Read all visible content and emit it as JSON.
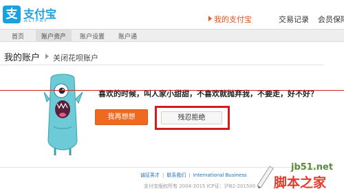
{
  "header": {
    "logo_glyph": "支",
    "logo_name": "支付宝",
    "logo_en": "ALIPAY",
    "nav": [
      {
        "label": "我的支付宝"
      },
      {
        "label": "交易记录"
      },
      {
        "label": "会员保障"
      }
    ]
  },
  "subnav": {
    "items": [
      {
        "label": "首页"
      },
      {
        "label": "账户资产"
      },
      {
        "label": "账户设置"
      },
      {
        "label": "账户通"
      }
    ]
  },
  "breadcrumb": {
    "title": "我的账户",
    "current": "关闭花呗账户"
  },
  "dialog": {
    "message": "喜欢的时候，叫人家小甜甜，不喜欢就抛弃我，不要走，好不好？",
    "think_again_label": "我再想想",
    "refuse_label": "残忍拒绝"
  },
  "footer": {
    "links": [
      "诚征英才",
      "联系我们",
      "International Business"
    ],
    "copyright": "支付宝版权所有 2004-2015 ICP证：沪B2-201500"
  },
  "watermark": {
    "url": "jb51.net",
    "name": "脚本之家"
  },
  "colors": {
    "brand": "#1a9fdf",
    "accent": "#ef6a1f",
    "annotation_red": "#d31c1c"
  }
}
